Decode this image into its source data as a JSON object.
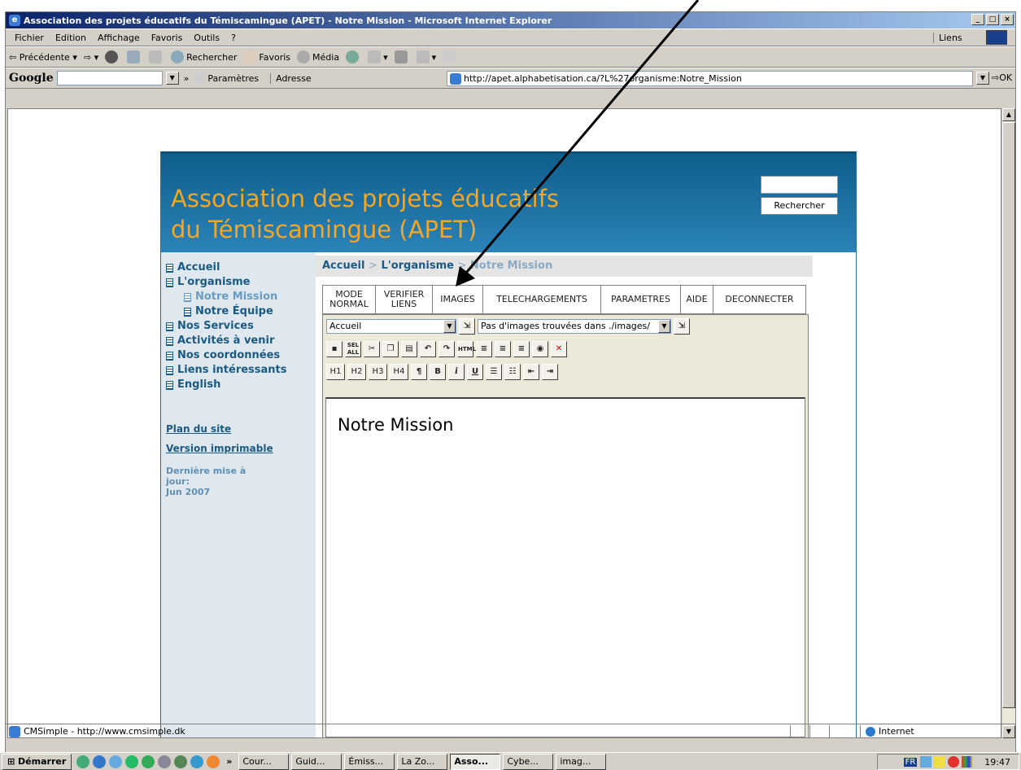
{
  "window": {
    "title": "Association des projets éducatifs du Témiscamingue (APET) - Notre Mission - Microsoft Internet Explorer"
  },
  "menubar": [
    "Fichier",
    "Edition",
    "Affichage",
    "Favoris",
    "Outils",
    "?"
  ],
  "menubar_links": "Liens",
  "toolbar": {
    "back": "Précédente",
    "search": "Rechercher",
    "favorites": "Favoris",
    "media": "Média"
  },
  "addressbar": {
    "google": "Google",
    "params": "Paramètres",
    "label": "Adresse",
    "url": "http://apet.alphabetisation.ca/?L%27organisme:Notre_Mission",
    "go": "OK"
  },
  "site": {
    "title_line1": "Association des projets éducatifs",
    "title_line2": "du Témiscamingue (APET)",
    "search_button": "Rechercher",
    "nav": [
      {
        "label": "Accueil",
        "level": 0
      },
      {
        "label": "L'organisme",
        "level": 0
      },
      {
        "label": "Notre Mission",
        "level": 1,
        "current": true
      },
      {
        "label": "Notre Équipe",
        "level": 1
      },
      {
        "label": "Nos Services",
        "level": 0
      },
      {
        "label": "Activités à venir",
        "level": 0
      },
      {
        "label": "Nos coordonnées",
        "level": 0
      },
      {
        "label": "Liens intéressants",
        "level": 0
      },
      {
        "label": "English",
        "level": 0
      }
    ],
    "sitemap": "Plan du site",
    "printable": "Version imprimable",
    "updated_label": "Dernière mise à jour:",
    "updated_date": "Jun 2007",
    "breadcrumb": {
      "home": "Accueil",
      "sep": ">",
      "section": "L'organisme",
      "current": "Notre Mission"
    }
  },
  "editor": {
    "tabs": [
      {
        "line1": "MODE",
        "line2": "NORMAL"
      },
      {
        "line1": "VERIFIER",
        "line2": "LIENS"
      },
      {
        "line1": "IMAGES",
        "line2": ""
      },
      {
        "line1": "TELECHARGEMENTS",
        "line2": ""
      },
      {
        "line1": "PARAMETRES",
        "line2": ""
      },
      {
        "line1": "AIDE",
        "line2": ""
      },
      {
        "line1": "DECONNECTER",
        "line2": ""
      }
    ],
    "page_select": "Accueil",
    "image_select": "Pas d'images trouvées dans ./images/",
    "toolbar1": [
      "save",
      "select-all",
      "cut",
      "copy",
      "paste",
      "undo",
      "redo",
      "html",
      "align-left",
      "align-center",
      "align-right",
      "link",
      "unlink"
    ],
    "toolbar2": [
      "H1",
      "H2",
      "H3",
      "H4",
      "¶",
      "B",
      "i",
      "U",
      "ul",
      "ol",
      "outdent",
      "indent"
    ],
    "content_heading": "Notre Mission"
  },
  "statusbar": {
    "text": "CMSimple - http://www.cmsimple.dk",
    "zone": "Internet"
  },
  "taskbar": {
    "start": "Démarrer",
    "buttons": [
      "Cour...",
      "Guid...",
      "Émiss...",
      "La Zo...",
      "Asso...",
      "Cybe...",
      "imag..."
    ],
    "active": "Asso...",
    "lang": "FR",
    "clock": "19:47"
  }
}
